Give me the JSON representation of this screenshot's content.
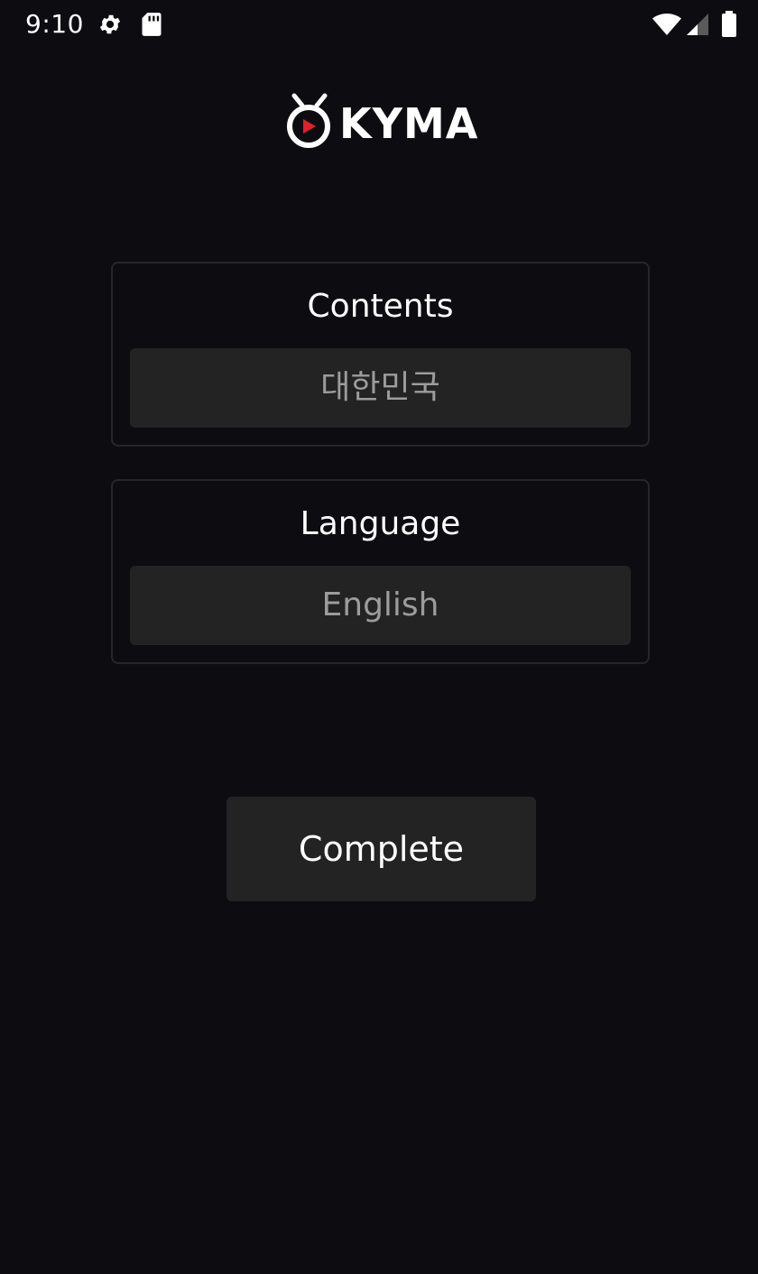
{
  "status_bar": {
    "time": "9:10",
    "icons": [
      "gear-icon",
      "sd-card-icon",
      "wifi-icon",
      "signal-icon",
      "battery-icon"
    ]
  },
  "logo": {
    "text": "KYMA",
    "accent_color": "#e0202a"
  },
  "contents": {
    "label": "Contents",
    "value": "대한민국"
  },
  "language": {
    "label": "Language",
    "value": "English"
  },
  "actions": {
    "complete_label": "Complete"
  },
  "colors": {
    "background": "#0d0d11",
    "field_background": "#232323",
    "panel_border": "#26262b",
    "field_text": "#9c9c9c"
  }
}
